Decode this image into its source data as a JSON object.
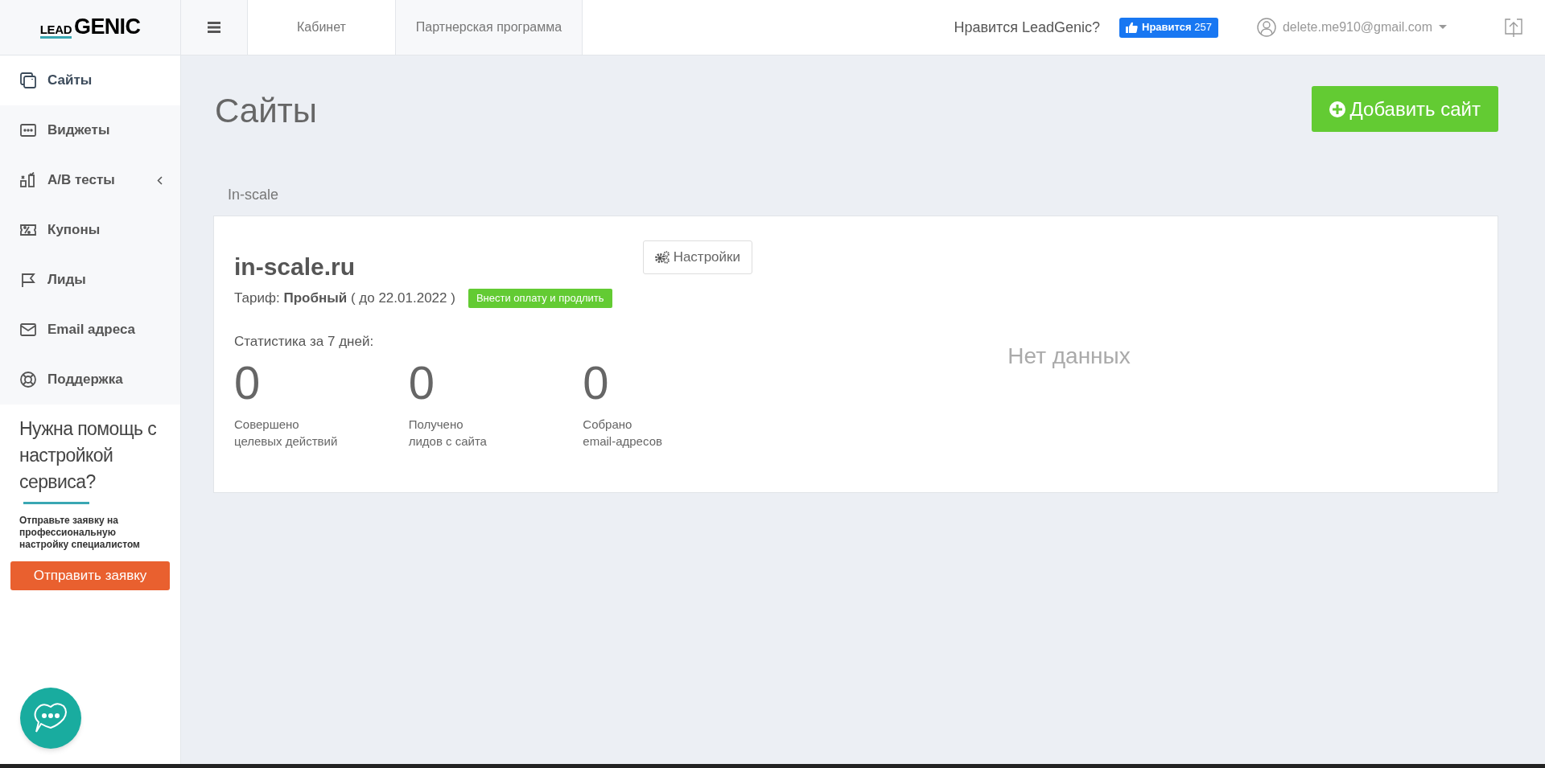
{
  "logo": {
    "small": "LEAD",
    "big": "GENIC"
  },
  "header": {
    "tabs": [
      {
        "label": "Кабинет",
        "selected": true
      },
      {
        "label": "Партнерская программа",
        "selected": false
      }
    ],
    "like_question": "Нравится LeadGenic?",
    "like_button": {
      "label": "Нравится",
      "count": "257"
    },
    "user_email": "delete.me910@gmail.com"
  },
  "sidebar": {
    "items": [
      {
        "label": "Сайты",
        "kind": "sites",
        "selected": true,
        "submenu": false
      },
      {
        "label": "Виджеты",
        "kind": "widgets",
        "selected": false,
        "submenu": false
      },
      {
        "label": "A/B тесты",
        "kind": "ab",
        "selected": false,
        "submenu": true
      },
      {
        "label": "Купоны",
        "kind": "coupons",
        "selected": false,
        "submenu": false
      },
      {
        "label": "Лиды",
        "kind": "leads",
        "selected": false,
        "submenu": false
      },
      {
        "label": "Email адреса",
        "kind": "email",
        "selected": false,
        "submenu": false
      },
      {
        "label": "Поддержка",
        "kind": "support",
        "selected": false,
        "submenu": false
      }
    ],
    "help": {
      "title": "Нужна помощь с настройкой сервиса?",
      "text": "Отправьте заявку на профессиональную настройку специалистом",
      "button": "Отправить заявку"
    }
  },
  "page": {
    "title": "Сайты",
    "add_button": "Добавить сайт",
    "group": "In-scale",
    "site": {
      "name": "in-scale.ru",
      "settings_button": "Настройки",
      "tariff": "Тариф: **Пробный** ( до 22.01.2022 )",
      "pay_button": "Внести оплату и продлить",
      "stats_title": "Статистика за 7 дней:",
      "stats": [
        {
          "value": "0",
          "label": "Совершено\nцелевых действий"
        },
        {
          "value": "0",
          "label": "Получено\nлидов с сайта"
        },
        {
          "value": "0",
          "label": "Собрано\nemail-адресов"
        }
      ],
      "no_data": "Нет данных"
    }
  }
}
